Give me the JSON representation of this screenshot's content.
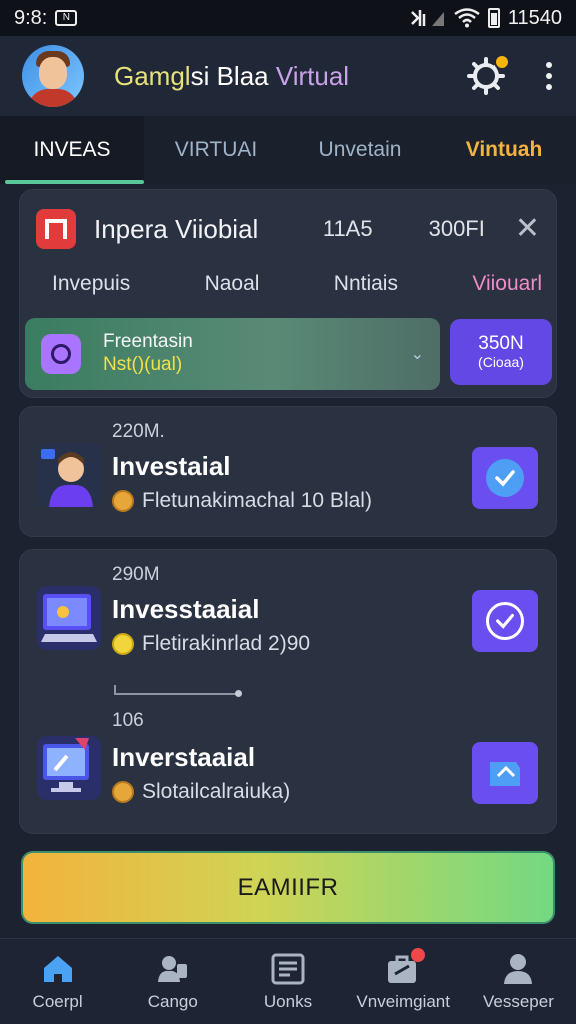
{
  "status_bar": {
    "time": "9:8:",
    "right_text": "11540",
    "nfc": "N",
    "icons": [
      "nfc-icon",
      "signal-icon",
      "wifi-icon",
      "battery-icon"
    ]
  },
  "app_bar": {
    "title_part1": "Gamgl",
    "title_part2": "si Blaa",
    "title_part3": " Virtual",
    "notification_count": "1"
  },
  "tabs": [
    {
      "label": "INVEAS"
    },
    {
      "label": "VIRTUAI"
    },
    {
      "label": "Unvetain"
    },
    {
      "label": "Vintuah"
    }
  ],
  "summary_card": {
    "title": "Inpera Viiobial",
    "value1": "11A5",
    "value2": "300FI",
    "labels": [
      "Invepuis",
      "Naoal",
      "Nntiais",
      "Viiouarl"
    ],
    "promo_line1": "Freentasin",
    "promo_line2": "Nst()(ual)",
    "promo_button_line1": "350N",
    "promo_button_line2": "(Cioaa)"
  },
  "items": [
    {
      "amount": "220M.",
      "title": "Investaial",
      "subtitle": "Fletunakimachal 10 Blal)",
      "status": "checked"
    },
    {
      "amount": "290M",
      "title": "Invesstaaial",
      "subtitle": "Fletirakinrlad 2)90",
      "status": "checked-outline"
    },
    {
      "amount": "106",
      "title": "Inverstaaial",
      "subtitle": "Slotailcalraiuka)",
      "status": "pending"
    }
  ],
  "cta": {
    "label": "EAMIIFR"
  },
  "bottom_nav": [
    {
      "label": "Coerpl",
      "icon": "home-icon",
      "active": true
    },
    {
      "label": "Cango",
      "icon": "people-icon"
    },
    {
      "label": "Uonks",
      "icon": "list-icon"
    },
    {
      "label": "Vnveimgiant",
      "icon": "briefcase-icon",
      "badge": true
    },
    {
      "label": "Vesseper",
      "icon": "profile-icon"
    }
  ],
  "colors": {
    "accent_green": "#59c79a",
    "accent_purple": "#6b4ef0",
    "accent_orange": "#f4b23f",
    "brand_red": "#e23b3b"
  }
}
